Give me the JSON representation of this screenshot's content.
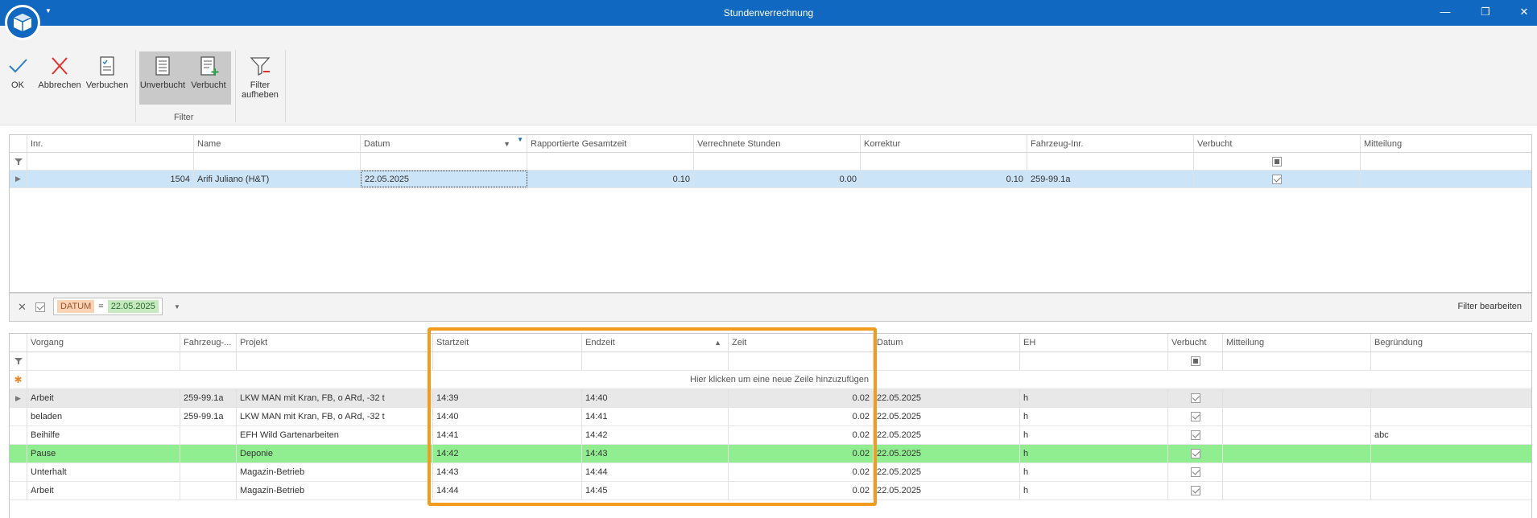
{
  "window": {
    "title": "Stundenverrechnung",
    "minimize": "—",
    "restore": "❐",
    "close": "✕"
  },
  "ribbon": {
    "ok_label": "OK",
    "abbrechen_label": "Abbrechen",
    "verbuchen_label": "Verbuchen",
    "unverbucht_label": "Unverbucht",
    "verbucht_label": "Verbucht",
    "filter_aufheben_line1": "Filter",
    "filter_aufheben_line2": "aufheben",
    "group_filter_label": "Filter"
  },
  "colors": {
    "titlebar": "#1068c0",
    "selected_row": "#cce4f7",
    "pause_row": "#90ee90",
    "highlight_border": "#f29b1d"
  },
  "top_grid": {
    "columns": [
      "Inr.",
      "Name",
      "Datum",
      "Rapportierte Gesamtzeit",
      "Verrechnete Stunden",
      "Korrektur",
      "Fahrzeug-Inr.",
      "Verbucht",
      "Mitteilung"
    ],
    "rows": [
      {
        "inr": "1504",
        "name": "Arifi Juliano (H&T)",
        "datum": "22.05.2025",
        "gesamtzeit": "0.10",
        "verrechnet": "0.00",
        "korrektur": "0.10",
        "fahrzeug": "259-99.1a",
        "verbucht": true,
        "mitteilung": ""
      }
    ]
  },
  "filter_panel": {
    "field": "DATUM",
    "operator": "=",
    "value": "22.05.2025",
    "edit_label": "Filter bearbeiten"
  },
  "bottom_grid": {
    "columns": [
      "Vorgang",
      "Fahrzeug-...",
      "Projekt",
      "Startzeit",
      "Endzeit",
      "Zeit",
      "Datum",
      "EH",
      "Verbucht",
      "Mitteilung",
      "Begründung"
    ],
    "new_row_text": "Hier klicken um eine neue Zeile hinzuzufügen",
    "rows": [
      {
        "vorgang": "Arbeit",
        "fahrzeug": "259-99.1a",
        "projekt": "LKW MAN mit Kran, FB, o ARd, -32 t",
        "start": "14:39",
        "end": "14:40",
        "zeit": "0.02",
        "datum": "22.05.2025",
        "eh": "h",
        "verbucht": true,
        "mitteilung": "",
        "begruendung": ""
      },
      {
        "vorgang": "beladen",
        "fahrzeug": "259-99.1a",
        "projekt": "LKW MAN mit Kran, FB, o ARd, -32 t",
        "start": "14:40",
        "end": "14:41",
        "zeit": "0.02",
        "datum": "22.05.2025",
        "eh": "h",
        "verbucht": true,
        "mitteilung": "",
        "begruendung": ""
      },
      {
        "vorgang": "Beihilfe",
        "fahrzeug": "",
        "projekt": "EFH Wild Gartenarbeiten",
        "start": "14:41",
        "end": "14:42",
        "zeit": "0.02",
        "datum": "22.05.2025",
        "eh": "h",
        "verbucht": true,
        "mitteilung": "",
        "begruendung": "abc"
      },
      {
        "vorgang": "Pause",
        "fahrzeug": "",
        "projekt": "Deponie",
        "start": "14:42",
        "end": "14:43",
        "zeit": "0.02",
        "datum": "22.05.2025",
        "eh": "h",
        "verbucht": true,
        "mitteilung": "",
        "begruendung": ""
      },
      {
        "vorgang": "Unterhalt",
        "fahrzeug": "",
        "projekt": "Magazin-Betrieb",
        "start": "14:43",
        "end": "14:44",
        "zeit": "0.02",
        "datum": "22.05.2025",
        "eh": "h",
        "verbucht": true,
        "mitteilung": "",
        "begruendung": ""
      },
      {
        "vorgang": "Arbeit",
        "fahrzeug": "",
        "projekt": "Magazin-Betrieb",
        "start": "14:44",
        "end": "14:45",
        "zeit": "0.02",
        "datum": "22.05.2025",
        "eh": "h",
        "verbucht": true,
        "mitteilung": "",
        "begruendung": ""
      }
    ]
  }
}
